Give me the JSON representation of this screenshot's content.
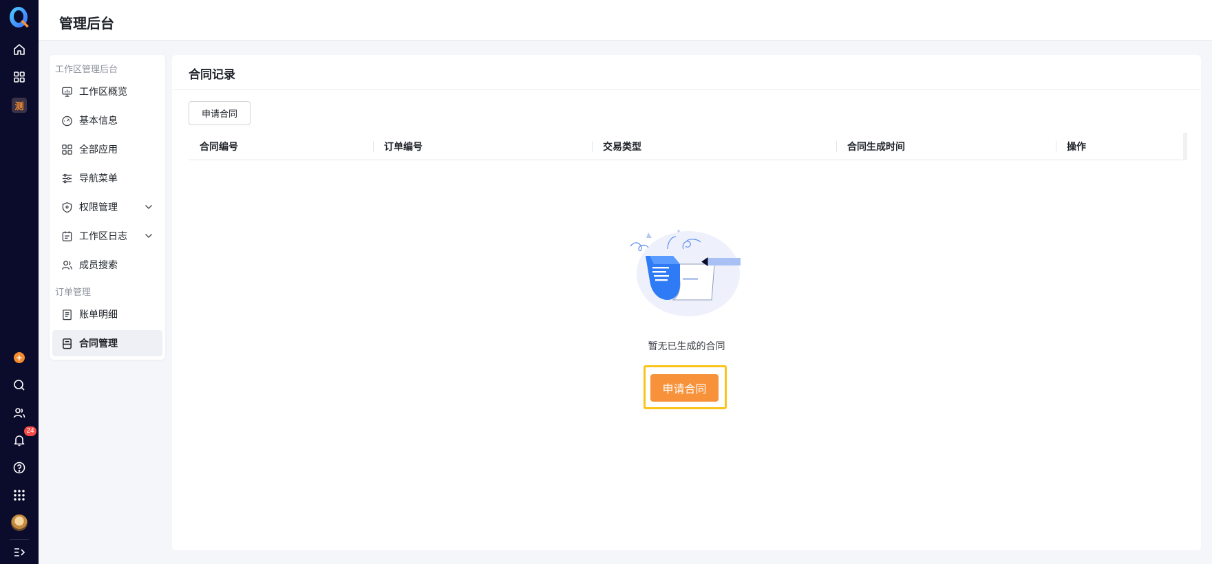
{
  "header": {
    "title": "管理后台"
  },
  "rail": {
    "icons": [
      "app-logo-icon",
      "home-icon",
      "grid-apps-icon",
      "workspace-app-icon",
      "add-icon",
      "search-icon",
      "contacts-icon",
      "notification-bell-icon",
      "help-icon",
      "app-launcher-icon",
      "avatar",
      "expand-sidebar-icon"
    ],
    "notification_count": "24",
    "workspace_glyph": "测"
  },
  "sidemenu": {
    "group_workspace": "工作区管理后台",
    "items_workspace": [
      {
        "label": "工作区概览",
        "icon": "dashboard-icon"
      },
      {
        "label": "基本信息",
        "icon": "speedometer-icon"
      },
      {
        "label": "全部应用",
        "icon": "grid-icon"
      },
      {
        "label": "导航菜单",
        "icon": "sliders-icon"
      },
      {
        "label": "权限管理",
        "icon": "shield-icon",
        "expandable": true
      },
      {
        "label": "工作区日志",
        "icon": "calendar-log-icon",
        "expandable": true
      },
      {
        "label": "成员搜索",
        "icon": "members-icon"
      }
    ],
    "group_order": "订单管理",
    "items_order": [
      {
        "label": "账单明细",
        "icon": "bill-icon"
      },
      {
        "label": "合同管理",
        "icon": "contract-icon",
        "active": true
      }
    ]
  },
  "main": {
    "title": "合同记录",
    "apply_button": "申请合同",
    "table": {
      "columns": [
        "合同编号",
        "订单编号",
        "交易类型",
        "合同生成时间",
        "操作"
      ],
      "rows": []
    },
    "empty_text": "暂无已生成的合同",
    "empty_button": "申请合同"
  },
  "colors": {
    "rail_bg": "#0b0b2b",
    "accent_orange": "#f7923b",
    "highlight_yellow": "#fbc31a",
    "badge_red": "#f54a45"
  }
}
